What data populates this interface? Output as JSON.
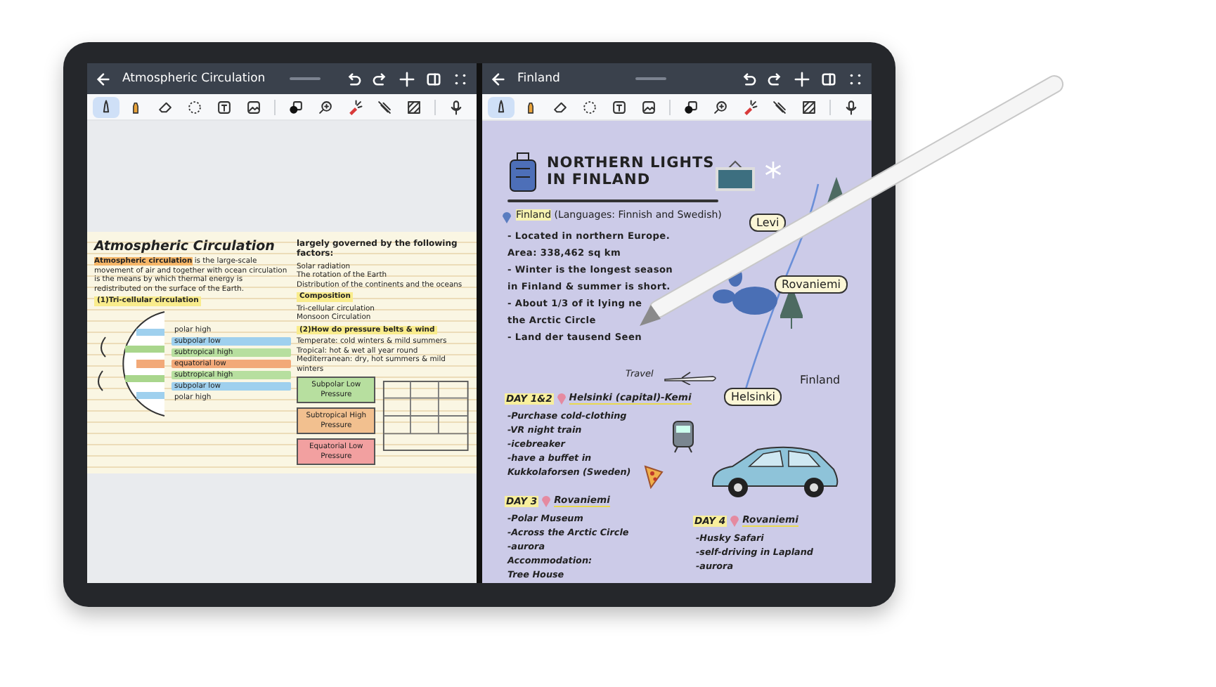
{
  "panes": [
    {
      "title": "Atmospheric Circulation",
      "tool_groups": [
        [
          {
            "kind": "pen",
            "selected": true
          },
          {
            "kind": "highlighter",
            "selected": false
          },
          {
            "kind": "eraser",
            "selected": false
          },
          {
            "kind": "lasso",
            "selected": false
          },
          {
            "kind": "text",
            "selected": false
          },
          {
            "kind": "image",
            "selected": false
          }
        ],
        [
          {
            "kind": "shape",
            "selected": false
          },
          {
            "kind": "zoom",
            "selected": false
          },
          {
            "kind": "laser",
            "selected": false
          },
          {
            "kind": "crossed",
            "selected": false
          },
          {
            "kind": "pattern",
            "selected": false
          }
        ],
        [
          {
            "kind": "mic",
            "selected": false
          }
        ]
      ]
    },
    {
      "title": "Finland",
      "tool_groups": [
        [
          {
            "kind": "pen",
            "selected": true
          },
          {
            "kind": "highlighter",
            "selected": false
          },
          {
            "kind": "eraser",
            "selected": false
          },
          {
            "kind": "lasso",
            "selected": false
          },
          {
            "kind": "text",
            "selected": false
          },
          {
            "kind": "image",
            "selected": false
          }
        ],
        [
          {
            "kind": "shape",
            "selected": false
          },
          {
            "kind": "zoom",
            "selected": false
          },
          {
            "kind": "laser",
            "selected": false
          },
          {
            "kind": "crossed",
            "selected": false
          },
          {
            "kind": "pattern",
            "selected": false
          }
        ],
        [
          {
            "kind": "mic",
            "selected": false
          }
        ]
      ]
    }
  ],
  "left_note": {
    "title": "Atmospheric Circulation",
    "intro": "**Atmospheric circulation** is the large-scale movement of air and together with ocean circulation is the means by which thermal energy is redistributed on the surface of the Earth.",
    "section_1": "(1)Tri-cellular circulation",
    "belts": [
      "polar high",
      "subpolar low",
      "subtropical high",
      "equatorial low",
      "subtropical high",
      "subpolar low",
      "polar high"
    ],
    "factors_heading": "largely governed by the following factors:",
    "factors": [
      "Solar radiation",
      "The rotation of the Earth",
      "Distribution of the continents and the oceans"
    ],
    "composition_heading": "Composition",
    "composition": [
      "Tri-cellular circulation",
      "Monsoon Circulation"
    ],
    "section_2": "(2)How do pressure belts & wind",
    "climates": [
      "Temperate: cold winters & mild summers",
      "Tropical: hot & wet all year round",
      "Mediterranean: dry, hot summers & mild winters"
    ],
    "pressure_belts": [
      "Subpolar Low Pressure",
      "Subtropical High Pressure",
      "Equatorial Low Pressure"
    ]
  },
  "right_note": {
    "title_lines": [
      "NORTHERN LIGHTS",
      "IN FINLAND"
    ],
    "country_heading": "**Finland** (Languages: Finnish and Swedish)",
    "facts": [
      "- Located in northern Europe.",
      "Area: 338,462 sq km",
      "- Winter is the longest season",
      "in Finland &  summer is short.",
      "- About 1/3 of it lying ne",
      "the Arctic Circle",
      "- Land der tausend Seen"
    ],
    "map_labels": [
      {
        "kind": "bubble",
        "text": "Levi"
      },
      {
        "kind": "bubble",
        "text": "Rovaniemi"
      },
      {
        "kind": "bubble",
        "text": "Helsinki"
      },
      {
        "kind": "plain",
        "text": "Finland"
      },
      {
        "kind": "plain",
        "text": "Travel"
      }
    ],
    "days": [
      {
        "day": "DAY 1&2",
        "place": "Helsinki (capital)-Kemi",
        "items": [
          "-Purchase cold-clothing",
          "-VR night train",
          "-icebreaker",
          "-have a buffet in",
          "Kukkolaforsen (Sweden)"
        ]
      },
      {
        "day": "DAY 3",
        "place": "Rovaniemi",
        "items": [
          "-Polar Museum",
          "-Across the Arctic Circle",
          "-aurora",
          "Accommodation:",
          "Tree House"
        ]
      },
      {
        "day": "DAY 4",
        "place": "Rovaniemi",
        "items": [
          "-Husky Safari",
          "-self-driving in Lapland",
          "-aurora"
        ]
      }
    ]
  }
}
